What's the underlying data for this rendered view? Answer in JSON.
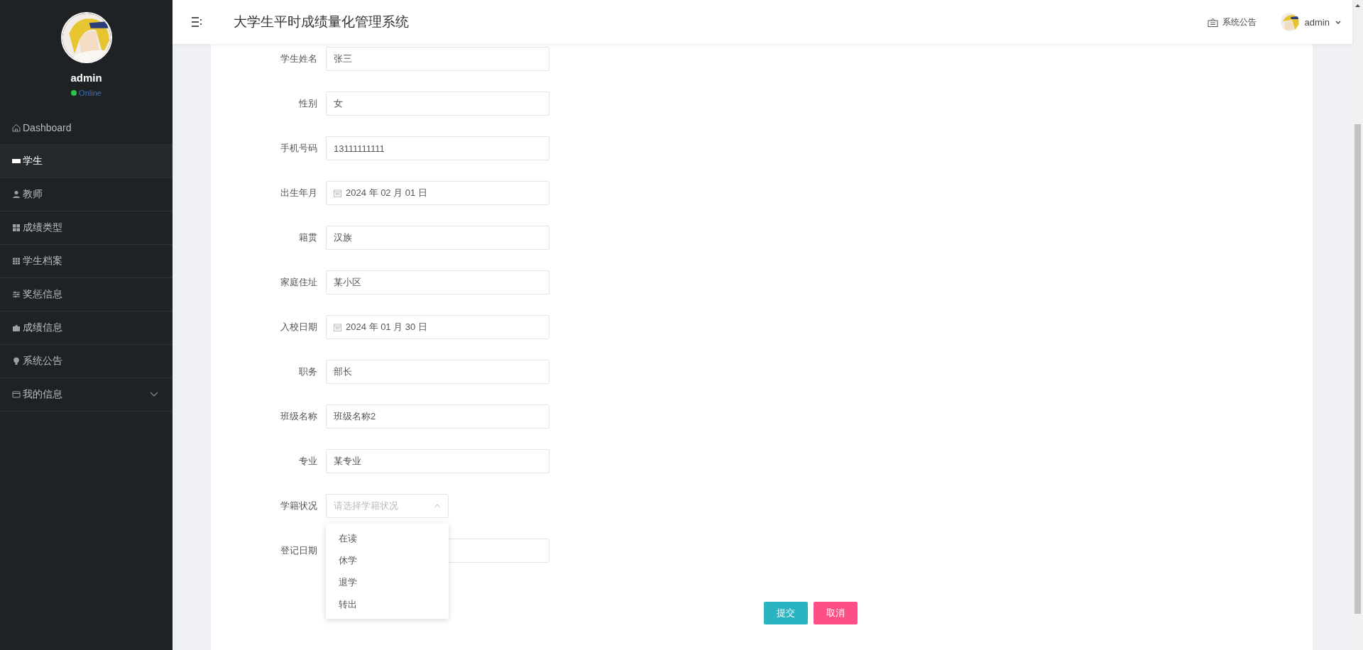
{
  "sidebar": {
    "user": {
      "name": "admin",
      "status": "Online"
    },
    "items": [
      {
        "label": "Dashboard",
        "selected": false,
        "submenu": false
      },
      {
        "label": "学生",
        "selected": true,
        "submenu": false
      },
      {
        "label": "教师",
        "selected": false,
        "submenu": false
      },
      {
        "label": "成绩类型",
        "selected": false,
        "submenu": false
      },
      {
        "label": "学生档案",
        "selected": false,
        "submenu": false
      },
      {
        "label": "奖惩信息",
        "selected": false,
        "submenu": false
      },
      {
        "label": "成绩信息",
        "selected": false,
        "submenu": false
      },
      {
        "label": "系统公告",
        "selected": false,
        "submenu": false
      },
      {
        "label": "我的信息",
        "selected": false,
        "submenu": true
      }
    ]
  },
  "header": {
    "title": "大学生平时成绩量化管理系统",
    "notice": "系统公告",
    "user": "admin"
  },
  "form": {
    "fields": [
      {
        "label": "学生姓名",
        "kind": "text",
        "value": "张三"
      },
      {
        "label": "性别",
        "kind": "text",
        "value": "女"
      },
      {
        "label": "手机号码",
        "kind": "text",
        "value": "13111111111"
      },
      {
        "label": "出生年月",
        "kind": "date",
        "value": "2024 年 02 月 01 日"
      },
      {
        "label": "籍贯",
        "kind": "text",
        "value": "汉族"
      },
      {
        "label": "家庭住址",
        "kind": "text",
        "value": "某小区"
      },
      {
        "label": "入校日期",
        "kind": "date",
        "value": "2024 年 01 月 30 日"
      },
      {
        "label": "职务",
        "kind": "text",
        "value": "部长"
      },
      {
        "label": "班级名称",
        "kind": "text",
        "value": "班级名称2"
      },
      {
        "label": "专业",
        "kind": "text",
        "value": "某专业"
      },
      {
        "label": "学籍状况",
        "kind": "select",
        "placeholder": "请选择学籍状况",
        "open": true,
        "options": [
          {
            "label": "在读",
            "selected": false
          },
          {
            "label": "休学",
            "selected": false
          },
          {
            "label": "退学",
            "selected": false
          },
          {
            "label": "转出",
            "selected": false
          }
        ]
      },
      {
        "label": "登记日期",
        "kind": "text"
      }
    ],
    "buttons": [
      {
        "label": "提交",
        "kind": "primary"
      },
      {
        "label": "取消",
        "kind": "danger"
      }
    ]
  }
}
